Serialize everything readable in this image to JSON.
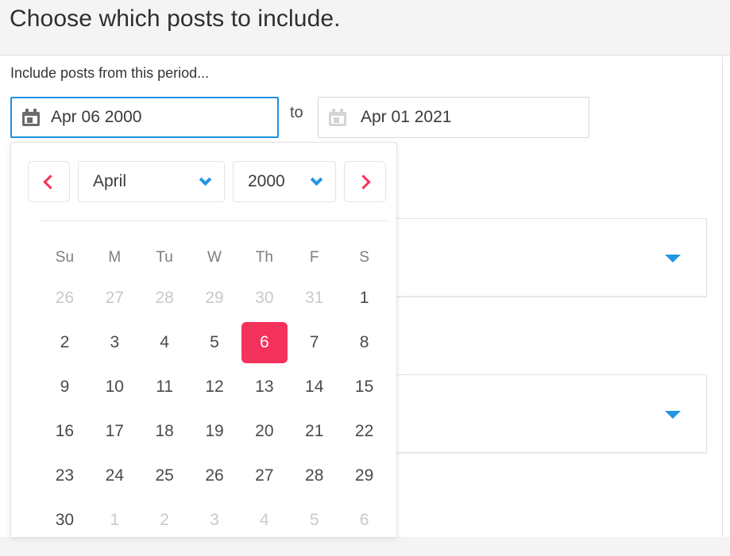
{
  "header": {
    "title": "Choose which posts to include."
  },
  "period": {
    "label": "Include posts from this period...",
    "from": {
      "icon": "calendar-icon",
      "value": "Apr 06 2000",
      "focused": true
    },
    "separator": "to",
    "until": {
      "icon": "calendar-icon",
      "value": "Apr 01 2021",
      "focused": false
    }
  },
  "background_selects": [
    {
      "icon": "triangle-down-icon",
      "value": ""
    },
    {
      "icon": "triangle-down-icon",
      "value": ""
    }
  ],
  "calendar": {
    "prev_icon": "chevron-left-icon",
    "next_icon": "chevron-right-icon",
    "month": "April",
    "year": "2000",
    "month_chevron_icon": "chevron-down-icon",
    "year_chevron_icon": "chevron-down-icon",
    "weekdays": [
      "Su",
      "M",
      "Tu",
      "W",
      "Th",
      "F",
      "S"
    ],
    "selected_day": 6,
    "weeks": [
      [
        {
          "d": "26",
          "muted": true
        },
        {
          "d": "27",
          "muted": true
        },
        {
          "d": "28",
          "muted": true
        },
        {
          "d": "29",
          "muted": true
        },
        {
          "d": "30",
          "muted": true
        },
        {
          "d": "31",
          "muted": true
        },
        {
          "d": "1",
          "muted": false
        }
      ],
      [
        {
          "d": "2",
          "muted": false
        },
        {
          "d": "3",
          "muted": false
        },
        {
          "d": "4",
          "muted": false
        },
        {
          "d": "5",
          "muted": false
        },
        {
          "d": "6",
          "muted": false,
          "selected": true
        },
        {
          "d": "7",
          "muted": false
        },
        {
          "d": "8",
          "muted": false
        }
      ],
      [
        {
          "d": "9",
          "muted": false
        },
        {
          "d": "10",
          "muted": false
        },
        {
          "d": "11",
          "muted": false
        },
        {
          "d": "12",
          "muted": false
        },
        {
          "d": "13",
          "muted": false
        },
        {
          "d": "14",
          "muted": false
        },
        {
          "d": "15",
          "muted": false
        }
      ],
      [
        {
          "d": "16",
          "muted": false
        },
        {
          "d": "17",
          "muted": false
        },
        {
          "d": "18",
          "muted": false
        },
        {
          "d": "19",
          "muted": false
        },
        {
          "d": "20",
          "muted": false
        },
        {
          "d": "21",
          "muted": false
        },
        {
          "d": "22",
          "muted": false
        }
      ],
      [
        {
          "d": "23",
          "muted": false
        },
        {
          "d": "24",
          "muted": false
        },
        {
          "d": "25",
          "muted": false
        },
        {
          "d": "26",
          "muted": false
        },
        {
          "d": "27",
          "muted": false
        },
        {
          "d": "28",
          "muted": false
        },
        {
          "d": "29",
          "muted": false
        }
      ],
      [
        {
          "d": "30",
          "muted": false
        },
        {
          "d": "1",
          "muted": true
        },
        {
          "d": "2",
          "muted": true
        },
        {
          "d": "3",
          "muted": true
        },
        {
          "d": "4",
          "muted": true
        },
        {
          "d": "5",
          "muted": true
        },
        {
          "d": "6",
          "muted": true
        }
      ]
    ]
  },
  "colors": {
    "accent_pink": "#f5325b",
    "accent_blue": "#2196e3",
    "focus_blue": "#1d8fe0",
    "header_band": "#f4f4f4",
    "text": "#333333",
    "muted_text": "#c9c9c9"
  }
}
